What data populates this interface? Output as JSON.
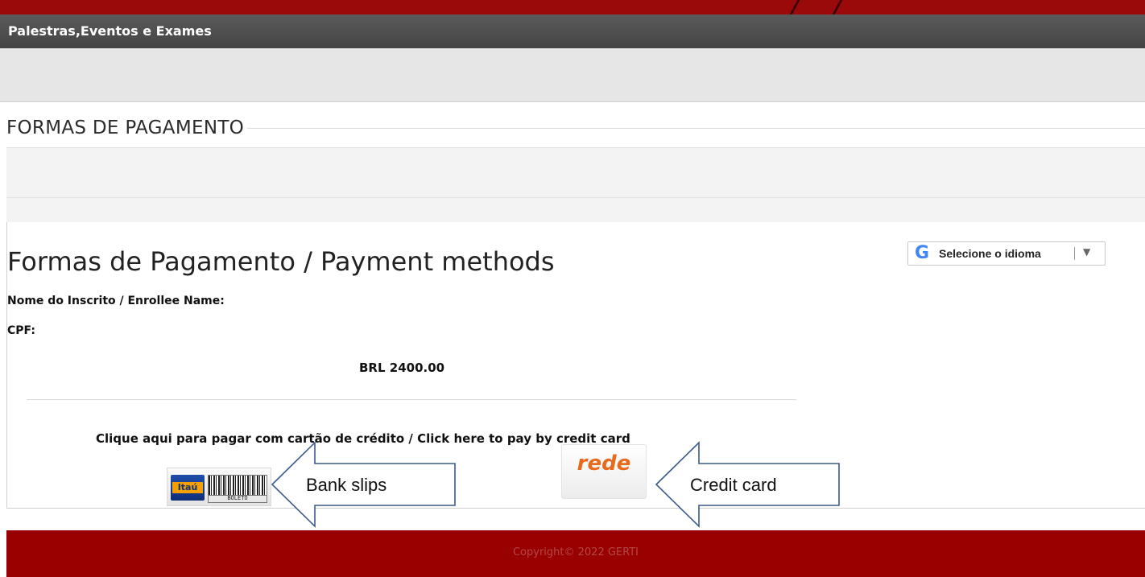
{
  "header": {
    "title": "Palestras,Eventos e Exames"
  },
  "section": {
    "title": "FORMAS DE PAGAMENTO"
  },
  "payment": {
    "heading": "Formas de Pagamento / Payment methods",
    "enrollee_label": "Nome do Inscrito / Enrollee Name:",
    "cpf_label": "CPF:",
    "amount": "BRL 2400.00",
    "credit_card_prompt": "Clique aqui para pagar com cartão de crédito / Click here to pay by credit card",
    "itau_logo_text": "Itaú",
    "boleto_text": "BOLETO",
    "rede_logo_text": "rede"
  },
  "translate": {
    "icon_letter": "G",
    "label": "Selecione o idioma",
    "arrow": "▼"
  },
  "annotations": {
    "bank_slips": "Bank slips",
    "credit_card": "Credit card"
  },
  "footer": {
    "copyright": "Copyright© 2022 GERTI"
  },
  "colors": {
    "brand_red": "#990000",
    "nav_grey": "#4f4f4f",
    "rede_orange": "#e86a1c"
  }
}
